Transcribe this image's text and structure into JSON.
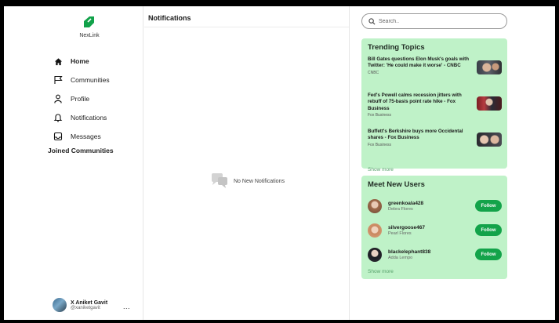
{
  "brand": {
    "name": "NexLink"
  },
  "nav": [
    {
      "label": "Home",
      "icon": "home-icon",
      "active": true
    },
    {
      "label": "Communities",
      "icon": "flag-icon"
    },
    {
      "label": "Profile",
      "icon": "person-icon"
    },
    {
      "label": "Notifications",
      "icon": "bell-icon"
    },
    {
      "label": "Messages",
      "icon": "inbox-icon"
    }
  ],
  "joined_communities": {
    "label": "Joined Communities"
  },
  "current_user": {
    "name": "X Aniket Gavit",
    "handle": "@xaniketgavit",
    "menu": "..."
  },
  "main": {
    "title": "Notifications",
    "empty_text": "No New Notifications"
  },
  "search": {
    "placeholder": "Search.."
  },
  "trending": {
    "title": "Trending Topics",
    "items": [
      {
        "title": "Bill Gates questions Elon Musk's goals with Twitter: 'He could make it worse' - CNBC",
        "source": "CNBC"
      },
      {
        "title": "Fed's Powell calms recession jitters with rebuff of 75-basis point rate hike - Fox Business",
        "source": "Fox Business"
      },
      {
        "title": "Buffett's Berkshire buys more Occidental shares - Fox Business",
        "source": "Fox Business"
      }
    ],
    "show_more": "Show more"
  },
  "meet_users": {
    "title": "Meet New Users",
    "items": [
      {
        "username": "greenkoala428",
        "realname": "Debra Flores"
      },
      {
        "username": "silvergoose467",
        "realname": "Pearl Flores"
      },
      {
        "username": "blackelephant838",
        "realname": "Adda Lempo"
      }
    ],
    "follow_label": "Follow",
    "show_more": "Show more"
  },
  "colors": {
    "accent": "#13a34a",
    "card_bg": "#bff2c8",
    "logo": "#12a24a"
  }
}
